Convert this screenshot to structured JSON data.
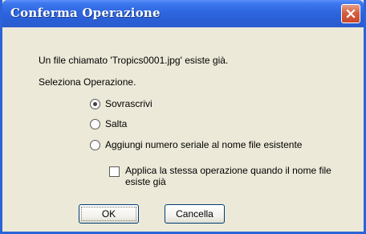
{
  "dialog": {
    "title": "Conferma Operazione"
  },
  "message": "Un file chiamato 'Tropics0001.jpg' esiste già.",
  "operation_label": "Seleziona Operazione.",
  "options": [
    {
      "label": "Sovrascrivi",
      "selected": true
    },
    {
      "label": "Salta",
      "selected": false
    },
    {
      "label": "Aggiungi numero seriale al nome file esistente",
      "selected": false
    }
  ],
  "apply_checkbox": {
    "label": "Applica la stessa operazione quando il nome file esiste già",
    "checked": false
  },
  "buttons": {
    "ok": "OK",
    "cancel": "Cancella"
  },
  "colors": {
    "title_bar": "#2a5fd6",
    "close_button": "#d4603f",
    "dialog_background": "#ece9d8",
    "button_border": "#003c74"
  },
  "icons": {
    "close": "close-icon"
  }
}
